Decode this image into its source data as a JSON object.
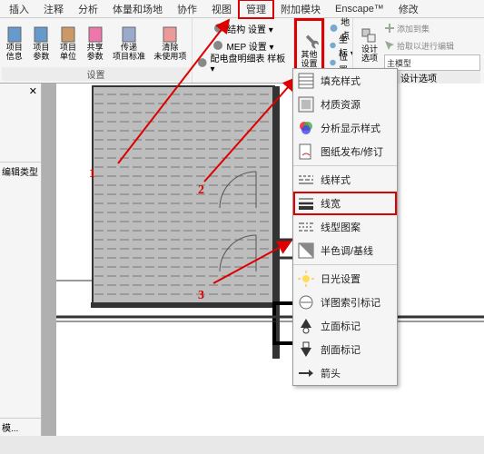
{
  "tabs": [
    "插入",
    "注释",
    "分析",
    "体量和场地",
    "协作",
    "视图",
    "管理",
    "附加模块",
    "Enscape™",
    "修改"
  ],
  "active_tab_index": 6,
  "panel1": {
    "btns": [
      "项目\n信息",
      "项目\n参数",
      "项目\n单位",
      "共享\n参数",
      "传递\n项目标准",
      "清除\n未使用项"
    ],
    "title": "设置"
  },
  "panel2_rows": [
    "结构 设置 ▾",
    "MEP 设置 ▾",
    "配电盘明细表 样板 ▾"
  ],
  "panel3": {
    "label": "其他\n设置"
  },
  "panel4_rows": [
    "地点",
    "坐标 ▾",
    "位置 ▾"
  ],
  "design": {
    "btns": [
      "添加到集",
      "拾取以进行编辑"
    ],
    "label": "设计\n选项",
    "combo": "主模型",
    "title": "设计选项"
  },
  "side": {
    "label1": "编辑类型",
    "label2": "模..."
  },
  "dropdown": [
    {
      "label": "填充样式",
      "icon": "hatch"
    },
    {
      "label": "材质资源",
      "icon": "mat"
    },
    {
      "label": "分析显示样式",
      "icon": "rgb"
    },
    {
      "label": "图纸发布/修订",
      "icon": "sheet"
    },
    {
      "label": "线样式",
      "icon": "lines-dash"
    },
    {
      "label": "线宽",
      "icon": "lines-weight",
      "selected": true
    },
    {
      "label": "线型图案",
      "icon": "lines-pat"
    },
    {
      "label": "半色调/基线",
      "icon": "half"
    },
    {
      "label": "日光设置",
      "icon": "sun"
    },
    {
      "label": "详图索引标记",
      "icon": "callout"
    },
    {
      "label": "立面标记",
      "icon": "elev"
    },
    {
      "label": "剖面标记",
      "icon": "section"
    },
    {
      "label": "箭头",
      "icon": "arrow-h"
    }
  ],
  "annotations": {
    "n1": "1",
    "n2": "2",
    "n3": "3"
  },
  "colors": {
    "accent": "#d00"
  }
}
